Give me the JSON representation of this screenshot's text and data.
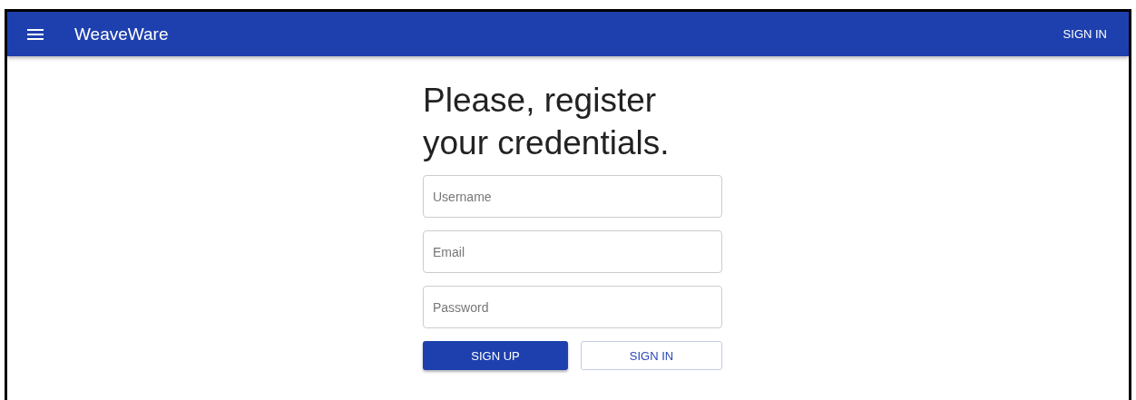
{
  "app_bar": {
    "app_name": "WeaveWare",
    "action": "SIGN IN"
  },
  "heading": "Please, register your credentials.",
  "fields": [
    {
      "placeholder": "Username"
    },
    {
      "placeholder": "Email"
    },
    {
      "placeholder": "Password"
    }
  ],
  "buttons": [
    {
      "label": "SIGN UP",
      "kind": "primary"
    },
    {
      "label": "SIGN IN",
      "kind": "outlined"
    }
  ]
}
